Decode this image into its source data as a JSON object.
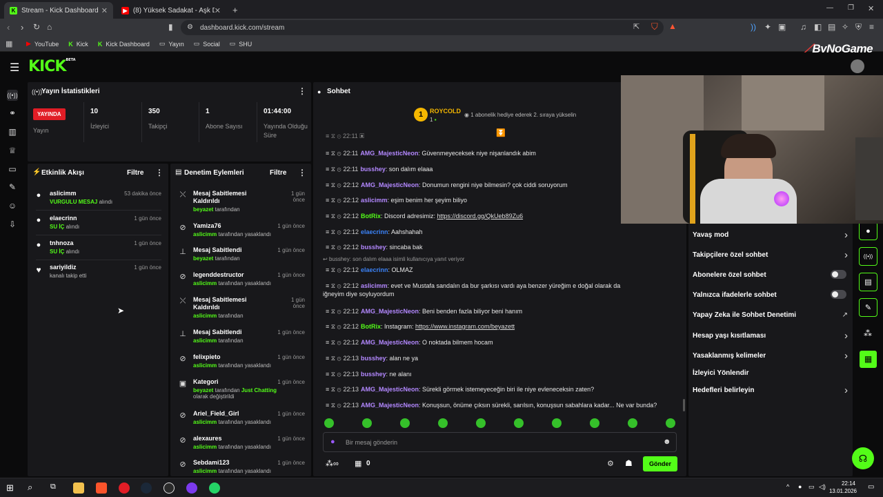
{
  "browser": {
    "tabs": [
      {
        "title": "Stream - Kick Dashboard",
        "active": true
      },
      {
        "title": "(8) Yüksek Sadakat - Aşk Durduk",
        "active": false
      }
    ],
    "url": "dashboard.kick.com/stream",
    "bookmarks": [
      "YouTube",
      "Kick",
      "Kick Dashboard",
      "Yayın",
      "Social",
      "SHU"
    ],
    "watermark": "ByNoGame"
  },
  "brand": {
    "logo": "KICK",
    "beta": "BETA",
    "accent": "#53fc18"
  },
  "stats": {
    "title": "Yayın İstatistikleri",
    "live_badge": "YAYINDA",
    "live_label": "Yayın",
    "items": [
      {
        "value": "10",
        "label": "İzleyici"
      },
      {
        "value": "350",
        "label": "Takipçi"
      },
      {
        "value": "1",
        "label": "Abone Sayısı"
      },
      {
        "value": "01:44:00",
        "label": "Yayında Olduğu Süre"
      }
    ]
  },
  "activity": {
    "title": "Etkinlik Akışı",
    "filter": "Filtre",
    "items": [
      {
        "name": "aslicimm",
        "time": "53 dakika önce",
        "hl": "VURGULU MESAJ",
        "rest": "alındı"
      },
      {
        "name": "elaecrinn",
        "time": "1 gün önce",
        "hl": "SU İÇ",
        "rest": "alındı"
      },
      {
        "name": "tnhnoza",
        "time": "1 gün önce",
        "hl": "SU İÇ",
        "rest": "alındı"
      },
      {
        "name": "sariyildiz",
        "time": "1 gün önce",
        "hl": "",
        "rest": "kanalı takip etti"
      }
    ]
  },
  "moderation": {
    "title": "Denetim Eylemleri",
    "filter": "Filtre",
    "items": [
      {
        "title": "Mesaj Sabitlemesi Kaldırıldı",
        "time": "1 gün önce",
        "actor": "beyazet",
        "action": "tarafından",
        "extra": "",
        "extra2": ""
      },
      {
        "title": "Yamiza76",
        "time": "1 gün önce",
        "actor": "aslicimm",
        "action": "tarafından yasaklandı",
        "extra": "",
        "extra2": ""
      },
      {
        "title": "Mesaj Sabitlendi",
        "time": "1 gün önce",
        "actor": "beyazet",
        "action": "tarafından",
        "extra": "",
        "extra2": ""
      },
      {
        "title": "legenddestructor",
        "time": "1 gün önce",
        "actor": "aslicimm",
        "action": "tarafından yasaklandı",
        "extra": "",
        "extra2": ""
      },
      {
        "title": "Mesaj Sabitlemesi Kaldırıldı",
        "time": "1 gün önce",
        "actor": "aslicimm",
        "action": "tarafından",
        "extra": "",
        "extra2": ""
      },
      {
        "title": "Mesaj Sabitlendi",
        "time": "1 gün önce",
        "actor": "aslicimm",
        "action": "tarafından",
        "extra": "",
        "extra2": ""
      },
      {
        "title": "felixpieto",
        "time": "1 gün önce",
        "actor": "aslicimm",
        "action": "tarafından yasaklandı",
        "extra": "",
        "extra2": ""
      },
      {
        "title": "Kategori",
        "time": "1 gün önce",
        "actor": "beyazet",
        "action": "tarafından",
        "extra": "Just Chatting",
        "extra2": "olarak değiştirildi"
      },
      {
        "title": "Ariel_Field_Girl",
        "time": "1 gün önce",
        "actor": "aslicimm",
        "action": "tarafından yasaklandı",
        "extra": "",
        "extra2": ""
      },
      {
        "title": "alexaures",
        "time": "1 gün önce",
        "actor": "aslicimm",
        "action": "tarafından yasaklandı",
        "extra": "",
        "extra2": ""
      },
      {
        "title": "Sebdami123",
        "time": "1 gün önce",
        "actor": "aslicimm",
        "action": "tarafından yasaklandı",
        "extra": "",
        "extra2": ""
      }
    ]
  },
  "chat": {
    "title": "Sohbet",
    "pinned_user": "ROYCOLD",
    "pinned_count": "1",
    "gift_text": "1 abonelik hediye ederek 2. sıraya yükselin",
    "reply_hint": "busshey: son dalım elaaa isimli kullanıcıya yanıt veriyor",
    "messages": [
      {
        "time": "22:11",
        "user": "AMG_MajesticNeon",
        "cls": "u1",
        "text": ": Güvenmeyeceksek niye nişanlandık abim"
      },
      {
        "time": "22:11",
        "user": "busshey",
        "cls": "u1",
        "text": ": son dalım elaaa"
      },
      {
        "time": "22:12",
        "user": "AMG_MajesticNeon",
        "cls": "u1",
        "text": ": Donumun rengini niye bilmesin? çok ciddi soruyorum"
      },
      {
        "time": "22:12",
        "user": "aslicimm",
        "cls": "u1",
        "text": ": eşim benim her şeyim biliyo"
      },
      {
        "time": "22:12",
        "user": "BotRix",
        "cls": "u2",
        "text": ": Discord adresimiz: ",
        "link": "https://discord.gg/QkUeb89Zu6"
      },
      {
        "time": "22:12",
        "user": "elaecrinn",
        "cls": "u3",
        "text": ": Aahshahah"
      },
      {
        "time": "22:12",
        "user": "busshey",
        "cls": "u1",
        "text": ": sincaba bak"
      },
      {
        "time": "22:12",
        "user": "elaecrinn",
        "cls": "u3",
        "text": ": OLMAZ"
      },
      {
        "time": "22:12",
        "user": "aslicimm",
        "cls": "u1",
        "text": ": evet ve Mustafa sandalın da bur şarkısı vardı aya benzer yüreğim e doğal olarak da",
        "cont": "iğneyim diye soyluyordum"
      },
      {
        "time": "22:12",
        "user": "AMG_MajesticNeon",
        "cls": "u1",
        "text": ": Beni benden fazla biliyor beni hanım"
      },
      {
        "time": "22:12",
        "user": "BotRix",
        "cls": "u2",
        "text": ": Instagram: ",
        "link": "https://www.instagram.com/beyazett"
      },
      {
        "time": "22:12",
        "user": "AMG_MajesticNeon",
        "cls": "u1",
        "text": ": O noktada bilmem hocam"
      },
      {
        "time": "22:13",
        "user": "busshey",
        "cls": "u1",
        "text": ": alan ne ya"
      },
      {
        "time": "22:13",
        "user": "busshey",
        "cls": "u1",
        "text": ": ne alanı"
      },
      {
        "time": "22:13",
        "user": "AMG_MajesticNeon",
        "cls": "u1",
        "text": ": Sürekli görmek istemeyeceğin biri ile niye evleneceksin zaten?"
      },
      {
        "time": "22:13",
        "user": "AMG_MajesticNeon",
        "cls": "u1",
        "text": ": Konuşsun, önüme çıksın sürekli, sarılsın, konuşsun sabahlara kadar... Ne var bunda?"
      }
    ],
    "input_placeholder": "Bir mesaj gönderin",
    "points": "0",
    "send": "Gönder"
  },
  "settings": {
    "items": [
      {
        "label": "Yavaş mod",
        "kind": "arrow"
      },
      {
        "label": "Takipçilere özel sohbet",
        "kind": "arrow"
      },
      {
        "label": "Abonelere özel sohbet",
        "kind": "toggle"
      },
      {
        "label": "Yalnızca ifadelerle sohbet",
        "kind": "toggle"
      },
      {
        "label": "Yapay Zeka ile Sohbet Denetimi",
        "kind": "ext"
      },
      {
        "label": "Hesap yaşı kısıtlaması",
        "kind": "arrow"
      },
      {
        "label": "Yasaklanmış kelimeler",
        "kind": "arrow"
      },
      {
        "label": "İzleyici Yönlendir",
        "kind": "none"
      },
      {
        "label": "Hedefleri belirleyin",
        "kind": "arrow"
      }
    ]
  },
  "taskbar": {
    "time": "22:14",
    "date": "13.01.2026"
  }
}
